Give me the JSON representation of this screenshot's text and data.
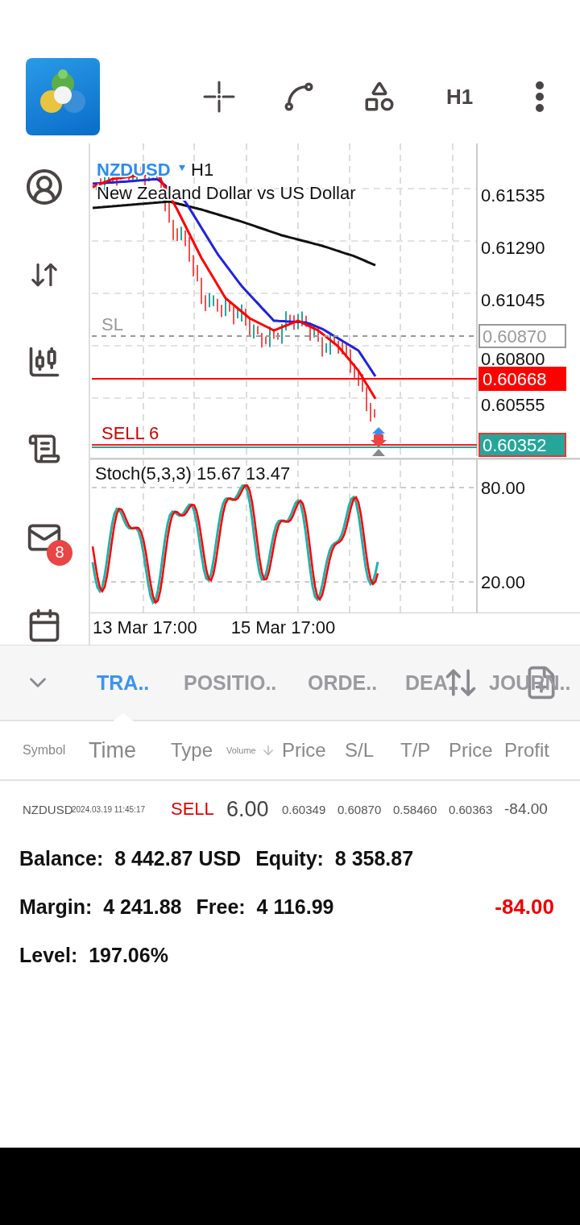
{
  "toolbar": {
    "timeframe": "H1"
  },
  "sidebar": {
    "mail_badge": "8"
  },
  "chart": {
    "symbol": "NZDUSD",
    "timeframe": "H1",
    "description": "New Zealand Dollar vs US Dollar",
    "price_labels": [
      "0.61535",
      "0.61290",
      "0.61045",
      "0.60800",
      "0.60555"
    ],
    "levels": [
      {
        "kind": "stop_loss",
        "label": "SL",
        "price": "0.60870"
      },
      {
        "kind": "bid",
        "price": "0.60668"
      },
      {
        "kind": "position",
        "label": "SELL 6",
        "price": "0.60352"
      }
    ],
    "indicator": {
      "title": "Stoch(5,3,3) 15.67 13.47",
      "levels": [
        "80.00",
        "20.00"
      ]
    },
    "time_labels": [
      "13 Mar 17:00",
      "15 Mar 17:00"
    ]
  },
  "tabs": [
    {
      "label": "TRA..",
      "selected": true
    },
    {
      "label": "POSITIO..",
      "selected": false
    },
    {
      "label": "ORDE..",
      "selected": false
    },
    {
      "label": "DEA..",
      "selected": false
    },
    {
      "label": "JOURN..",
      "selected": false
    }
  ],
  "table": {
    "columns": [
      "Symbol",
      "Time",
      "Type",
      "Volume",
      "Price",
      "S/L",
      "T/P",
      "Price",
      "Profit"
    ],
    "rows": [
      {
        "symbol": "NZDUSD",
        "time": "2024.03.19 11:45:17",
        "type": "SELL",
        "volume": "6.00",
        "open_price": "0.60349",
        "sl": "0.60870",
        "tp": "0.58460",
        "price": "0.60363",
        "profit": "-84.00"
      }
    ]
  },
  "summary": {
    "balance_label": "Balance:",
    "balance": "8 442.87 USD",
    "equity_label": "Equity:",
    "equity": "8 358.87",
    "margin_label": "Margin:",
    "margin": "4 241.88",
    "free_label": "Free:",
    "free": "4 116.99",
    "total_profit": "-84.00",
    "level_label": "Level:",
    "level_value": "197.06%"
  }
}
